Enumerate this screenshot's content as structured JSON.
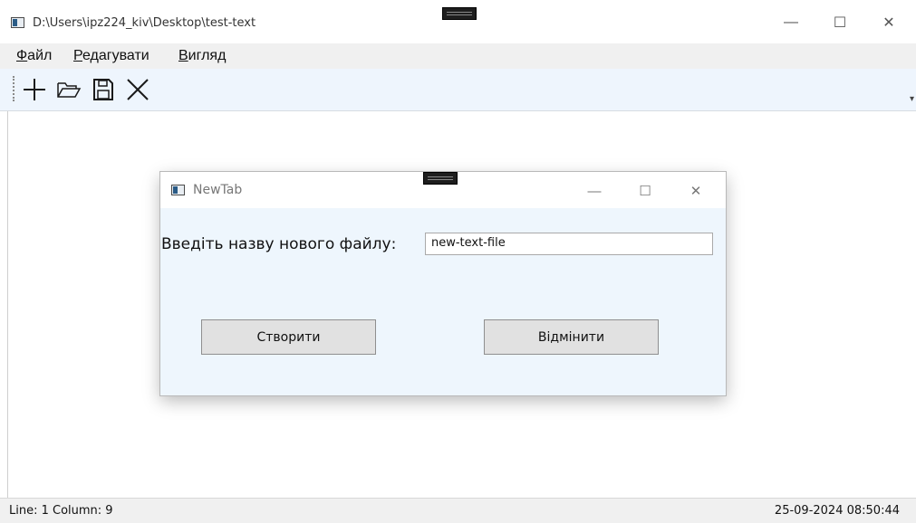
{
  "window": {
    "title": "D:\\Users\\ipz224_kiv\\Desktop\\test-text",
    "minimize_glyph": "—",
    "maximize_glyph": "☐",
    "close_glyph": "✕"
  },
  "menu": {
    "items": [
      {
        "accel": "Ф",
        "rest": "айл"
      },
      {
        "accel": "Р",
        "rest": "едагувати"
      },
      {
        "accel": "В",
        "rest": "игляд"
      }
    ]
  },
  "toolbar": {
    "buttons": [
      "new-icon",
      "open-folder-icon",
      "save-icon",
      "close-icon"
    ],
    "overflow_glyph": "▾"
  },
  "dialog": {
    "title": "NewTab",
    "label": "Введіть назву нового файлу:",
    "input_value": "new-text-file",
    "create_label": "Створити",
    "cancel_label": "Відмінити",
    "minimize_glyph": "—",
    "maximize_glyph": "☐",
    "close_glyph": "✕"
  },
  "status": {
    "position": "Line:  1 Column:  9",
    "datetime": "25-09-2024 08:50:44"
  }
}
